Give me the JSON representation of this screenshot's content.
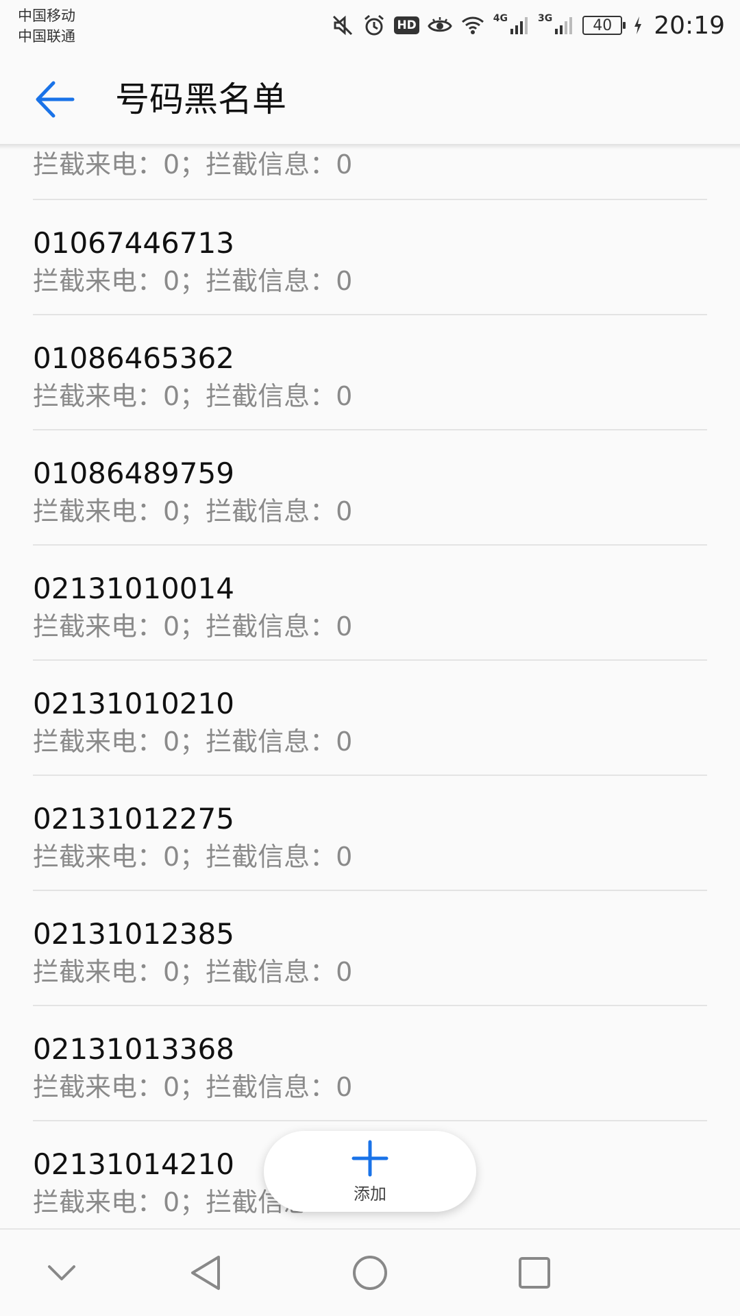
{
  "status_bar": {
    "carrier_1": "中国移动",
    "carrier_2": "中国联通",
    "hd_badge": "HD",
    "net_4g": "4G",
    "net_3g": "3G",
    "battery": "40",
    "time": "20:19"
  },
  "header": {
    "title": "号码黑名单",
    "back_icon": "arrow-left-icon",
    "accent_color": "#1a73e8"
  },
  "list": {
    "partial_top_stats": "拦截来电：0；拦截信息：0",
    "items": [
      {
        "number": "01067446713",
        "stats": "拦截来电：0；拦截信息：0"
      },
      {
        "number": "01086465362",
        "stats": "拦截来电：0；拦截信息：0"
      },
      {
        "number": "01086489759",
        "stats": "拦截来电：0；拦截信息：0"
      },
      {
        "number": "02131010014",
        "stats": "拦截来电：0；拦截信息：0"
      },
      {
        "number": "02131010210",
        "stats": "拦截来电：0；拦截信息：0"
      },
      {
        "number": "02131012275",
        "stats": "拦截来电：0；拦截信息：0"
      },
      {
        "number": "02131012385",
        "stats": "拦截来电：0；拦截信息：0"
      },
      {
        "number": "02131013368",
        "stats": "拦截来电：0；拦截信息：0"
      },
      {
        "number": "02131014210",
        "stats": "拦截来电：0；拦截信息：0"
      }
    ]
  },
  "fab": {
    "label": "添加",
    "icon": "plus-icon"
  },
  "nav": {
    "icons": [
      "chevron-down-icon",
      "back-triangle-icon",
      "home-circle-icon",
      "recents-square-icon"
    ]
  }
}
